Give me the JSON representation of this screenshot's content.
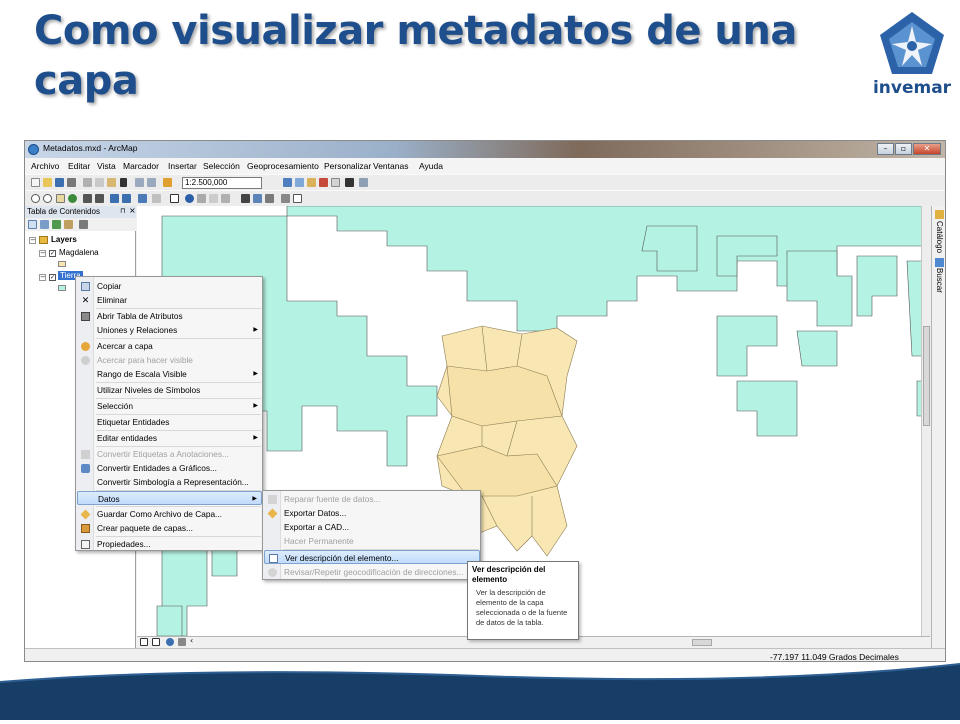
{
  "slide": {
    "title": "Como visualizar metadatos de una capa",
    "logo_text": "invemar"
  },
  "window": {
    "title": "Metadatos.mxd - ArcMap"
  },
  "menubar": [
    "Archivo",
    "Editar",
    "Vista",
    "Marcador",
    "Insertar",
    "Selección",
    "Geoprocesamiento",
    "Personalizar",
    "Ventanas",
    "Ayuda"
  ],
  "toolbar": {
    "scale": "1:2.500,000"
  },
  "toc": {
    "header": "Tabla de Contenidos",
    "layers_label": "Layers",
    "layer1": "Magdalena",
    "layer2": "Tierra"
  },
  "context_menu": {
    "items": [
      {
        "label": "Copiar",
        "icon": "copy-icon"
      },
      {
        "label": "Eliminar",
        "icon": "delete-icon"
      },
      {
        "label": "Abrir Tabla de Atributos",
        "icon": "table-icon"
      },
      {
        "label": "Uniones y Relaciones",
        "icon": ""
      },
      {
        "label": "Acercar a capa",
        "icon": "zoom-layer-icon"
      },
      {
        "label": "Acercar para hacer visible",
        "icon": "zoom-visible-icon"
      },
      {
        "label": "Rango de Escala Visible",
        "icon": ""
      },
      {
        "label": "Utilizar Niveles de Símbolos",
        "icon": ""
      },
      {
        "label": "Selección",
        "icon": ""
      },
      {
        "label": "Etiquetar Entidades",
        "icon": ""
      },
      {
        "label": "Editar entidades",
        "icon": ""
      },
      {
        "label": "Convertir Etiquetas a Anotaciones...",
        "icon": "annotation-icon"
      },
      {
        "label": "Convertir Entidades a Gráficos...",
        "icon": "graphics-icon"
      },
      {
        "label": "Convertir Simbología a Representación...",
        "icon": ""
      },
      {
        "label": "Datos",
        "icon": ""
      },
      {
        "label": "Guardar Como Archivo de Capa...",
        "icon": "layer-file-icon"
      },
      {
        "label": "Crear paquete de capas...",
        "icon": "package-icon"
      },
      {
        "label": "Propiedades...",
        "icon": "properties-icon"
      }
    ]
  },
  "submenu": {
    "items": [
      {
        "label": "Reparar fuente de datos..."
      },
      {
        "label": "Exportar Datos..."
      },
      {
        "label": "Exportar a CAD..."
      },
      {
        "label": "Hacer Permanente"
      },
      {
        "label": "Ver descripción del elemento..."
      },
      {
        "label": "Revisar/Repetir geocodificación de direcciones..."
      }
    ]
  },
  "tooltip": {
    "title": "Ver descripción del elemento",
    "body": "Ver la descripción de elemento de la capa seleccionada o de la fuente de datos de la tabla."
  },
  "right_panel": {
    "catalog": "Catálogo",
    "search": "Buscar"
  },
  "status": {
    "coords": "-77.197  11.049 Grados Decimales"
  },
  "colors": {
    "sea_polygons": "#b4f2e3",
    "land_polygons": "#f8e7b3",
    "title": "#1f4e8c",
    "footer": "#173e66"
  }
}
